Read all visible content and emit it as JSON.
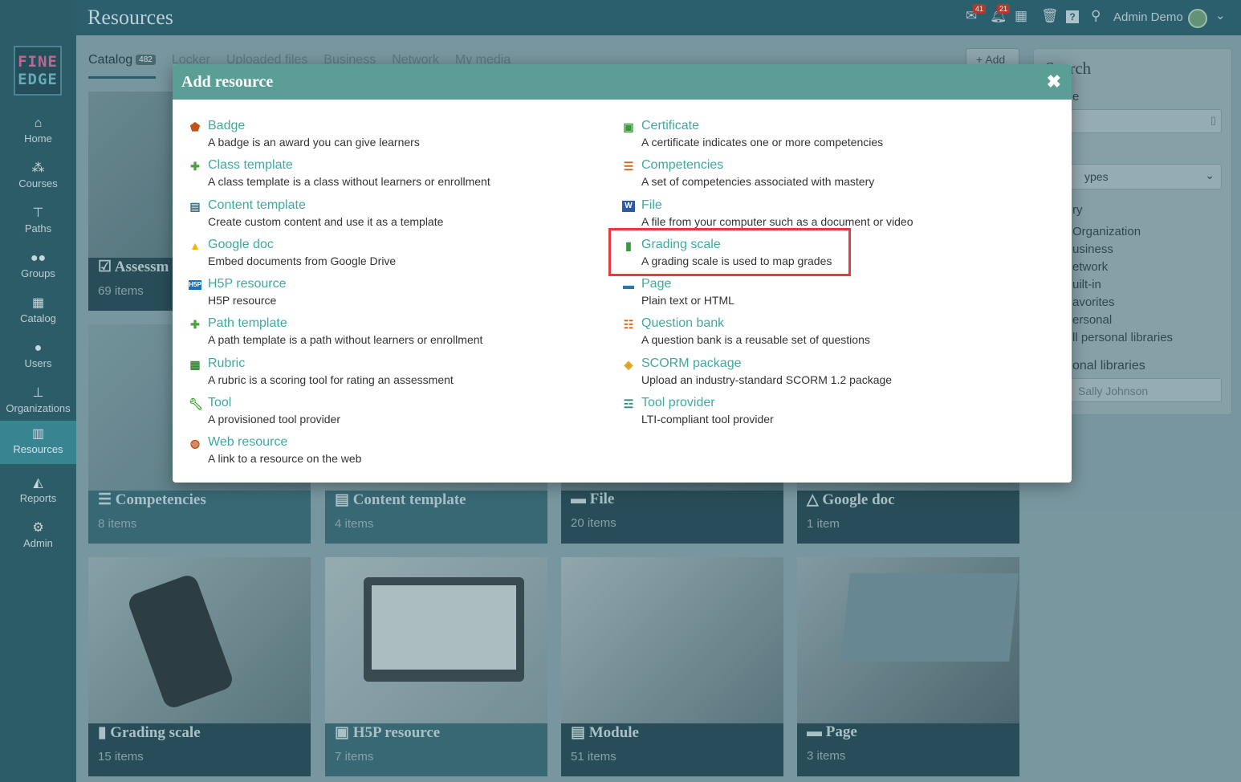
{
  "app": {
    "title": "Resources",
    "logo_line1": "FINE",
    "logo_line2": "EDGE",
    "user_name": "Admin Demo",
    "inbox_count": "41",
    "notifications_count": "21"
  },
  "sidebar": {
    "items": [
      {
        "label": "Home",
        "icon": "home-icon"
      },
      {
        "label": "Courses",
        "icon": "courses-icon"
      },
      {
        "label": "Paths",
        "icon": "paths-icon"
      },
      {
        "label": "Groups",
        "icon": "groups-icon"
      },
      {
        "label": "Catalog",
        "icon": "catalog-icon"
      },
      {
        "label": "Users",
        "icon": "users-icon"
      },
      {
        "label": "Organizations",
        "icon": "organizations-icon"
      },
      {
        "label": "Resources",
        "icon": "resources-icon",
        "active": true
      },
      {
        "label": "Reports",
        "icon": "reports-icon"
      },
      {
        "label": "Admin",
        "icon": "admin-icon"
      }
    ]
  },
  "tabs": [
    {
      "label": "Catalog",
      "count": "482"
    },
    {
      "label": "Locker"
    },
    {
      "label": "Uploaded files"
    },
    {
      "label": "Business"
    },
    {
      "label": "Network"
    },
    {
      "label": "My media"
    }
  ],
  "add_button": "Add",
  "cards": [
    {
      "title": "Assessm",
      "count": "69 items"
    },
    {
      "title": "Competencies",
      "count": "8 items"
    },
    {
      "title": "Content template",
      "count": "4 items"
    },
    {
      "title": "File",
      "count": "20 items"
    },
    {
      "title": "Google doc",
      "count": "1 item"
    },
    {
      "title": "Grading scale",
      "count": "15 items"
    },
    {
      "title": "H5P resource",
      "count": "7 items"
    },
    {
      "title": "Module",
      "count": "51 items"
    },
    {
      "title": "Page",
      "count": "3 items"
    }
  ],
  "search_panel": {
    "title": "Search",
    "name_label": "e",
    "type_select": "ypes",
    "library_label": "ry",
    "libraries": [
      "Organization",
      "usiness",
      "etwork",
      "uilt-in",
      "avorites",
      "ersonal",
      "ll personal libraries"
    ],
    "personal_label": "onal libraries",
    "personal_placeholder": "Sally Johnson"
  },
  "modal": {
    "title": "Add resource",
    "close": "✖",
    "left_items": [
      {
        "name": "Badge",
        "desc": "A badge is an award you can give learners",
        "icon": "badge-icon",
        "color": "#c0531a"
      },
      {
        "name": "Class template",
        "desc": "A class template is a class without learners or enrollment",
        "icon": "puzzle-icon",
        "color": "#4aa33c"
      },
      {
        "name": "Content template",
        "desc": "Create custom content and use it as a template",
        "icon": "content-template-icon",
        "color": "#2c7a86"
      },
      {
        "name": "Google doc",
        "desc": "Embed documents from Google Drive",
        "icon": "google-drive-icon",
        "color": "#f4b400"
      },
      {
        "name": "H5P resource",
        "desc": "H5P resource",
        "icon": "h5p-icon",
        "color": "#1a73b8"
      },
      {
        "name": "Path template",
        "desc": "A path template is a path without learners or enrollment",
        "icon": "puzzle-icon",
        "color": "#4aa33c"
      },
      {
        "name": "Rubric",
        "desc": "A rubric is a scoring tool for rating an assessment",
        "icon": "rubric-icon",
        "color": "#3a8a3a"
      },
      {
        "name": "Tool",
        "desc": "A provisioned tool provider",
        "icon": "wrench-icon",
        "color": "#4aa33c"
      },
      {
        "name": "Web resource",
        "desc": "A link to a resource on the web",
        "icon": "globe-icon",
        "color": "#c0531a"
      }
    ],
    "right_items": [
      {
        "name": "Certificate",
        "desc": "A certificate indicates one or more competencies",
        "icon": "certificate-icon",
        "color": "#3a9a3a"
      },
      {
        "name": "Competencies",
        "desc": "A set of competencies associated with mastery",
        "icon": "competencies-icon",
        "color": "#d0661a"
      },
      {
        "name": "File",
        "desc": "A file from your computer such as a document or video",
        "icon": "word-file-icon",
        "color": "#2a5aa8"
      },
      {
        "name": "Grading scale",
        "desc": "A grading scale is used to map grades",
        "icon": "bar-chart-icon",
        "color": "#3a9a3a"
      },
      {
        "name": "Page",
        "desc": "Plain text or HTML",
        "icon": "page-icon",
        "color": "#2a7aa8"
      },
      {
        "name": "Question bank",
        "desc": "A question bank is a reusable set of questions",
        "icon": "question-bank-icon",
        "color": "#d0661a"
      },
      {
        "name": "SCORM package",
        "desc": "Upload an industry-standard SCORM 1.2 package",
        "icon": "cube-icon",
        "color": "#d8a012"
      },
      {
        "name": "Tool provider",
        "desc": "LTI-compliant tool provider",
        "icon": "server-icon",
        "color": "#2a8a8a"
      }
    ]
  }
}
